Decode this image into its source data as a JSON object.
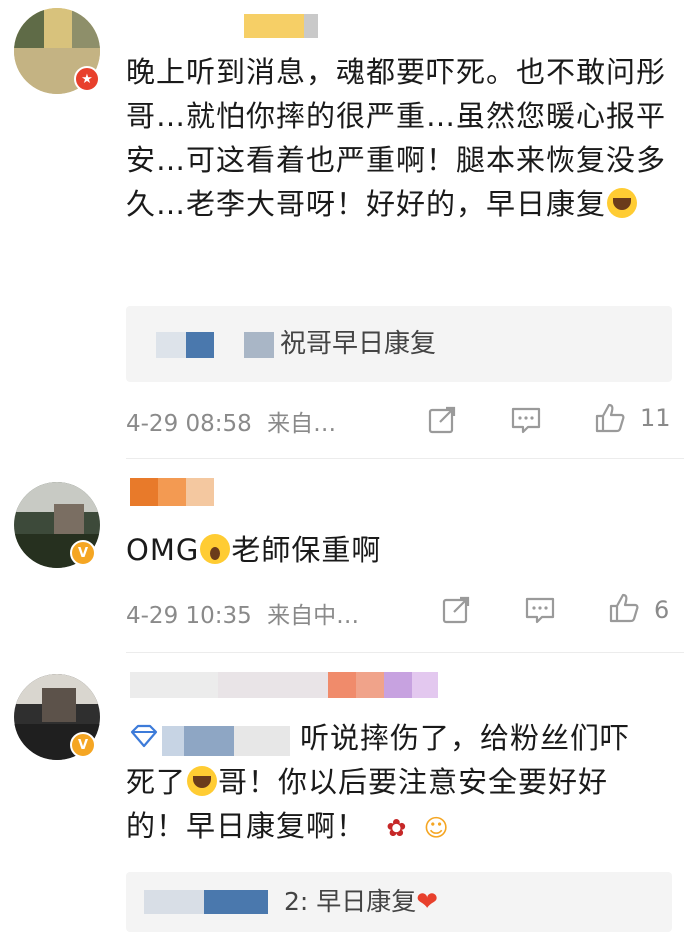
{
  "comments": [
    {
      "text": "晚上听到消息，魂都要吓死。也不敢问彤哥…就怕你摔的很严重…虽然您暖心报平安…可这看着也严重啊！腿本来恢复没多久…老李大哥呀！好好的，早日康复",
      "reply_text": "祝哥早日康复",
      "time": "4-29 08:58",
      "source": "来自…",
      "likes": "11"
    },
    {
      "text_prefix": "OMG",
      "text_suffix": "老師保重啊",
      "time": "4-29 10:35",
      "source": "来自中…",
      "likes": "6"
    },
    {
      "text_line1": "听说摔伤了，给粉丝们吓",
      "text_line2a": "死了",
      "text_line2b": "哥！你以后要注意安全要好好",
      "text_line3": "的！早日康复啊！",
      "reply_text": "2: 早日康复"
    }
  ],
  "icons": {
    "share": "share-icon",
    "comment": "comment-icon",
    "like": "thumbs-up-icon",
    "badge_red": "red-badge-icon",
    "badge_gold": "gold-v-badge-icon"
  },
  "colors": {
    "meta_gray": "#8a8a8a",
    "reply_bg": "#f4f4f4",
    "badge_gold": "#f5a623",
    "badge_red": "#e8402c"
  }
}
